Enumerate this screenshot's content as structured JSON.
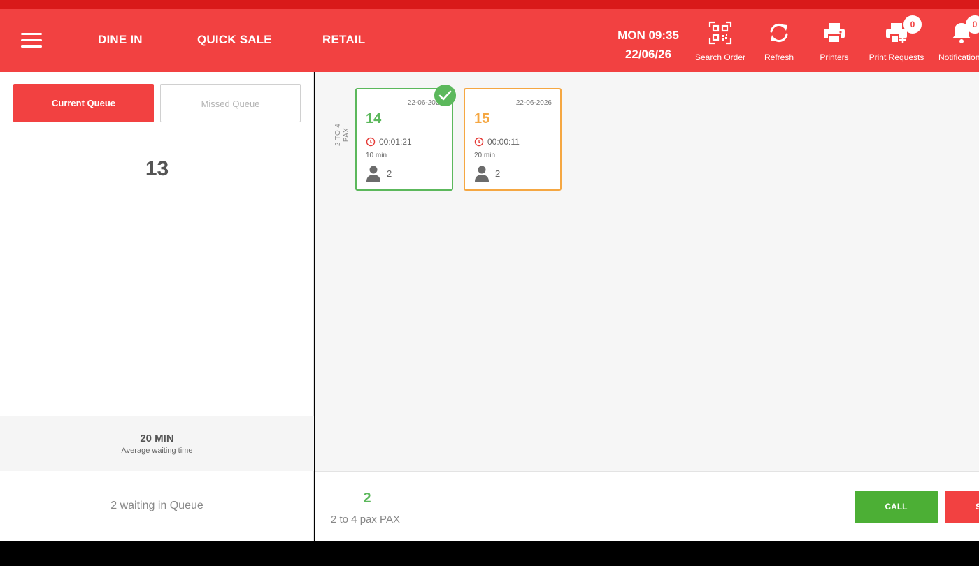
{
  "header": {
    "tabs": [
      {
        "label": "DINE IN"
      },
      {
        "label": "QUICK SALE"
      },
      {
        "label": "RETAIL"
      }
    ],
    "clock": {
      "time": "MON 09:35",
      "date": "22/06/26"
    },
    "buttons": {
      "search_order": {
        "label": "Search Order",
        "icon": "qr-code-icon"
      },
      "refresh": {
        "label": "Refresh",
        "icon": "refresh-icon"
      },
      "printers": {
        "label": "Printers",
        "icon": "printer-icon"
      },
      "print_requests": {
        "label": "Print Requests",
        "icon": "printer-plus-icon",
        "badge": "0"
      },
      "notifications": {
        "label": "Notification",
        "icon": "bell-icon",
        "badge": "0"
      }
    },
    "colors": {
      "header_bg": "#f24141",
      "strip": "#d91a1a"
    }
  },
  "left_panel": {
    "tabs": {
      "current": "Current Queue",
      "missed": "Missed Queue"
    },
    "current_number": "13",
    "average": {
      "value": "20 MIN",
      "label": "Average waiting time"
    },
    "waiting_text": "2 waiting in Queue"
  },
  "main": {
    "group_label": {
      "line1": "2 TO 4",
      "line2": "PAX"
    },
    "tickets": [
      {
        "date": "22-06-2026",
        "number": "14",
        "elapsed": "00:01:21",
        "estimate": "10 min",
        "pax": "2",
        "status": "selected",
        "color": "#5cb85c"
      },
      {
        "date": "22-06-2026",
        "number": "15",
        "elapsed": "00:00:11",
        "estimate": "20 min",
        "pax": "2",
        "status": "waiting",
        "color": "#f5a742"
      }
    ]
  },
  "bottom": {
    "selected_pax": "2",
    "selected_desc": "2 to 4 pax PAX",
    "call_label": "CALL",
    "next_label": "S"
  }
}
